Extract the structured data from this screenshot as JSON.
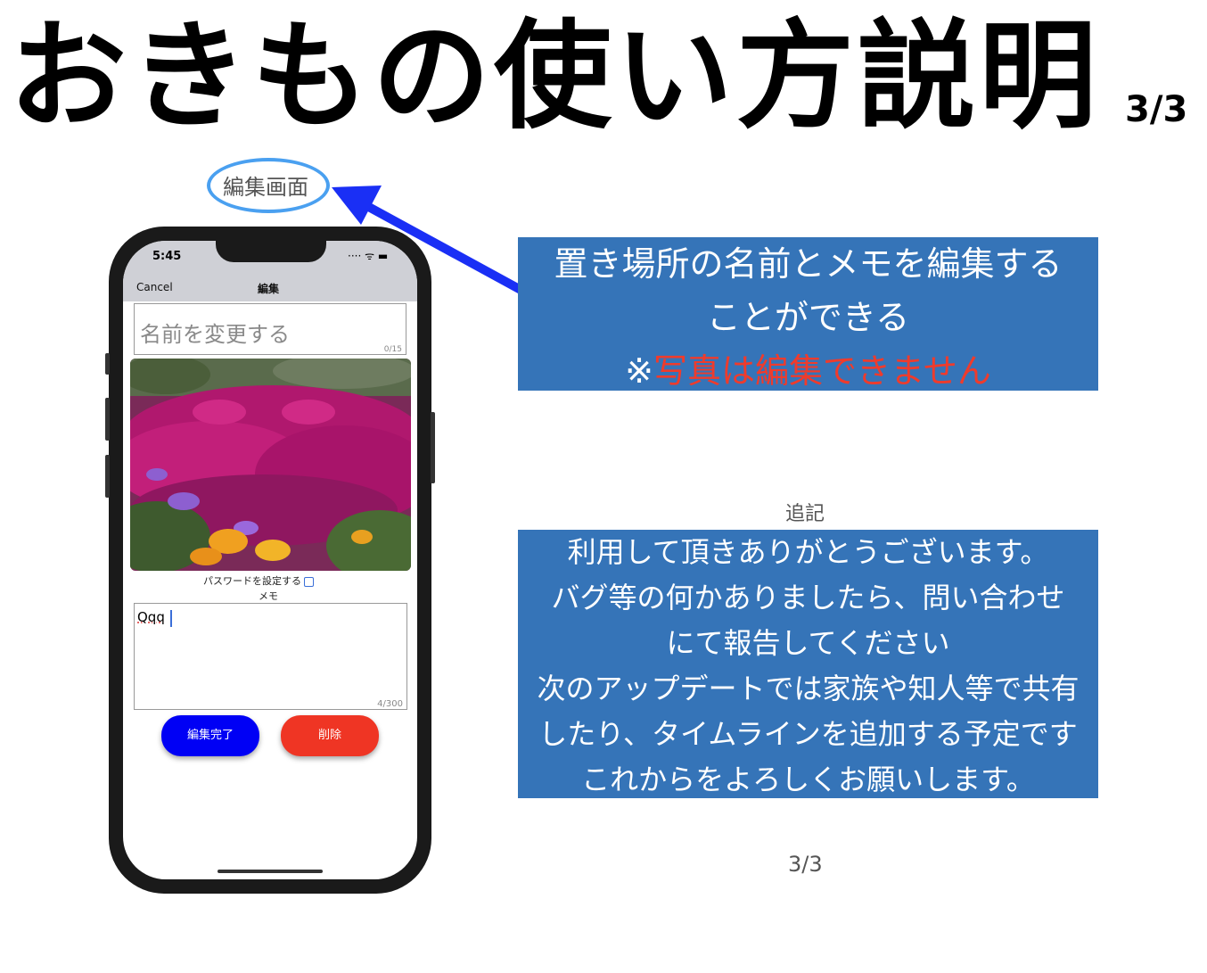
{
  "slide": {
    "title": "おきもの使い方説明",
    "title_page": "3/3",
    "screen_label": "編集画面",
    "page_number": "3/3"
  },
  "phone": {
    "status": {
      "time": "5:45",
      "icons": "···· ᯤ ▬"
    },
    "nav": {
      "cancel_label": "Cancel",
      "title": "編集"
    },
    "name_field": {
      "placeholder": "名前を変更する",
      "counter": "0/15"
    },
    "photo": {
      "description_icon": "flower-photo"
    },
    "password_label": "パスワードを設定する",
    "memo_label": "メモ",
    "memo": {
      "value": "Qqq",
      "counter": "4/300"
    },
    "buttons": {
      "done_label": "編集完了",
      "delete_label": "削除"
    }
  },
  "callout": {
    "line1": "置き場所の名前とメモを編集する",
    "line2": "ことができる",
    "note_mark": "※",
    "note_red": "写真は編集できません"
  },
  "addendum": {
    "heading": "追記",
    "lines": [
      "利用して頂きありがとうございます。",
      "バグ等の何かありましたら、問い合わせ",
      "にて報告してください",
      "次のアップデートでは家族や知人等で共有",
      "したり、タイムラインを追加する予定です",
      "これからをよろしくお願いします。"
    ]
  },
  "colors": {
    "box_blue": "#3574b8",
    "note_red": "#ef3b2c",
    "done_button": "#0000f5",
    "delete_button": "#ef3524",
    "arrow_blue": "#1a2ff5",
    "ellipse_blue": "#4aa0f0"
  }
}
